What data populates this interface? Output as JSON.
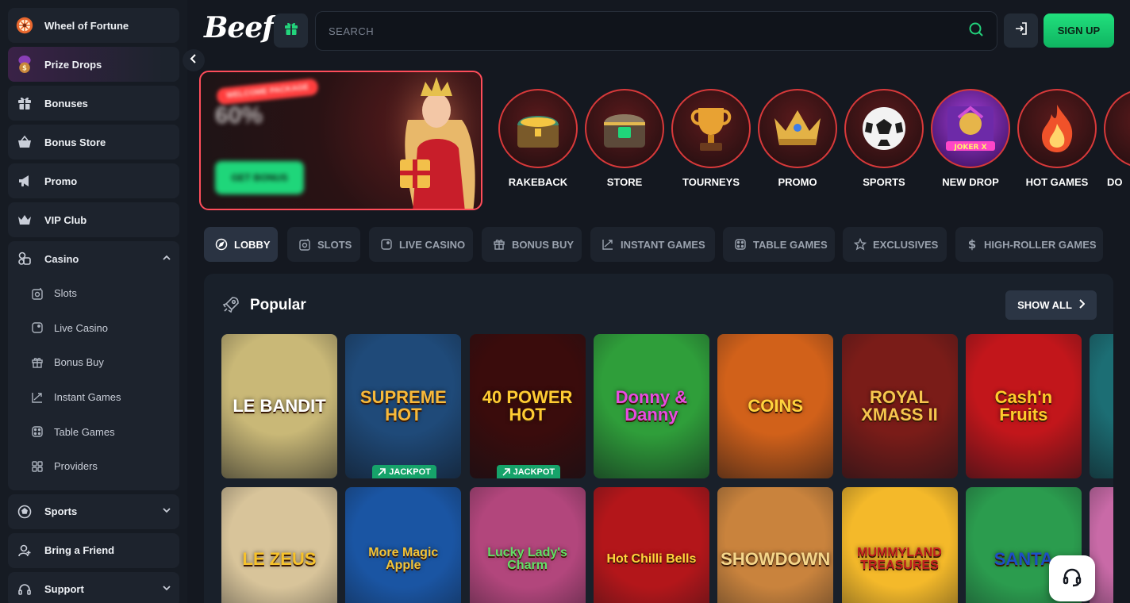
{
  "sidebar": {
    "top_items": [
      {
        "label": "Wheel of Fortune",
        "icon": "wheel-icon"
      },
      {
        "label": "Prize Drops",
        "icon": "prize-bag-icon"
      },
      {
        "label": "Bonuses",
        "icon": "gift-icon"
      },
      {
        "label": "Bonus Store",
        "icon": "basket-icon"
      },
      {
        "label": "Promo",
        "icon": "megaphone-icon"
      },
      {
        "label": "VIP Club",
        "icon": "crown-icon"
      }
    ],
    "casino": {
      "label": "Casino",
      "icon": "dice-icon",
      "expanded": true,
      "items": [
        {
          "label": "Slots",
          "icon": "slot-icon"
        },
        {
          "label": "Live Casino",
          "icon": "live-icon"
        },
        {
          "label": "Bonus Buy",
          "icon": "bonus-buy-icon"
        },
        {
          "label": "Instant Games",
          "icon": "instant-icon"
        },
        {
          "label": "Table Games",
          "icon": "table-dice-icon"
        },
        {
          "label": "Providers",
          "icon": "grid-icon"
        }
      ]
    },
    "bottom_items": [
      {
        "label": "Sports",
        "icon": "ball-icon",
        "has_chevron": true
      },
      {
        "label": "Bring a Friend",
        "icon": "add-user-icon",
        "has_chevron": false
      },
      {
        "label": "Support",
        "icon": "headset-icon",
        "has_chevron": true
      }
    ]
  },
  "header": {
    "logo": "Beef",
    "search_placeholder": "SEARCH",
    "signup_label": "SIGN UP"
  },
  "banner": {
    "tag": "WELCOME PACKAGE",
    "amount": "60%",
    "cta": "GET BONUS"
  },
  "categories": [
    {
      "label": "RAKEBACK",
      "icon": "treasure-chest-icon"
    },
    {
      "label": "STORE",
      "icon": "store-chest-icon"
    },
    {
      "label": "TOURNEYS",
      "icon": "trophy-icon"
    },
    {
      "label": "PROMO",
      "icon": "crown-icon"
    },
    {
      "label": "SPORTS",
      "icon": "soccer-ball-icon"
    },
    {
      "label": "NEW DROP",
      "icon": "joker-icon"
    },
    {
      "label": "HOT GAMES",
      "icon": "flame-icon"
    },
    {
      "label": "DO",
      "icon": "partial-icon"
    }
  ],
  "tabs": [
    {
      "label": "LOBBY",
      "icon": "compass-icon",
      "active": true
    },
    {
      "label": "SLOTS",
      "icon": "slot-icon",
      "active": false
    },
    {
      "label": "LIVE CASINO",
      "icon": "live-icon",
      "active": false
    },
    {
      "label": "BONUS BUY",
      "icon": "bonus-buy-icon",
      "active": false
    },
    {
      "label": "INSTANT GAMES",
      "icon": "instant-icon",
      "active": false
    },
    {
      "label": "TABLE GAMES",
      "icon": "table-dice-icon",
      "active": false
    },
    {
      "label": "EXCLUSIVES",
      "icon": "star-icon",
      "active": false
    },
    {
      "label": "HIGH-ROLLER GAMES",
      "icon": "dollar-icon",
      "active": false
    }
  ],
  "popular": {
    "title": "Popular",
    "show_all": "SHOW ALL",
    "jackpot_label": "JACKPOT",
    "row1": [
      {
        "name": "LE BANDIT",
        "bg": "#c9b877",
        "fg": "#ffffff",
        "jackpot": false
      },
      {
        "name": "SUPREME HOT",
        "bg": "#1f4a79",
        "fg": "#f7b93a",
        "jackpot": true
      },
      {
        "name": "40 POWER HOT",
        "bg": "#3a0c0c",
        "fg": "#ffcc33",
        "jackpot": true
      },
      {
        "name": "Donny & Danny",
        "bg": "#2f9e3a",
        "fg": "#e84be0",
        "jackpot": false
      },
      {
        "name": "COINS",
        "bg": "#d1611a",
        "fg": "#ffd23d",
        "jackpot": false
      },
      {
        "name": "ROYAL XMASS II",
        "bg": "#7a1c18",
        "fg": "#f6c64e",
        "jackpot": false
      },
      {
        "name": "Cash'n Fruits",
        "bg": "#c2161b",
        "fg": "#ffcc2b",
        "jackpot": false
      },
      {
        "name": "",
        "bg": "#1c6e74",
        "fg": "#ffffff",
        "jackpot": false
      }
    ],
    "row2": [
      {
        "name": "LE ZEUS",
        "bg": "#d8c49a",
        "fg": "#f6c22b",
        "jackpot": false
      },
      {
        "name": "More Magic Apple",
        "bg": "#1a55a3",
        "fg": "#f3c53a",
        "jackpot": false
      },
      {
        "name": "Lucky Lady's Charm",
        "bg": "#b2467c",
        "fg": "#62e067",
        "jackpot": false
      },
      {
        "name": "Hot Chilli Bells",
        "bg": "#b3161a",
        "fg": "#ffd53b",
        "jackpot": false
      },
      {
        "name": "SHOWDOWN",
        "bg": "#c9833d",
        "fg": "#f5d68a",
        "jackpot": false
      },
      {
        "name": "MUMMYLAND TREASURES",
        "bg": "#f4b92a",
        "fg": "#c21f1f",
        "jackpot": false
      },
      {
        "name": "SANTA",
        "bg": "#2b9c4e",
        "fg": "#1d4fc6",
        "jackpot": false
      },
      {
        "name": "",
        "bg": "#c96aa7",
        "fg": "#ffffff",
        "jackpot": false
      }
    ]
  },
  "colors": {
    "background": "#141820",
    "sidebar": "#161b23",
    "accent_green": "#1fd67a",
    "accent_red": "#ff4d5a"
  }
}
